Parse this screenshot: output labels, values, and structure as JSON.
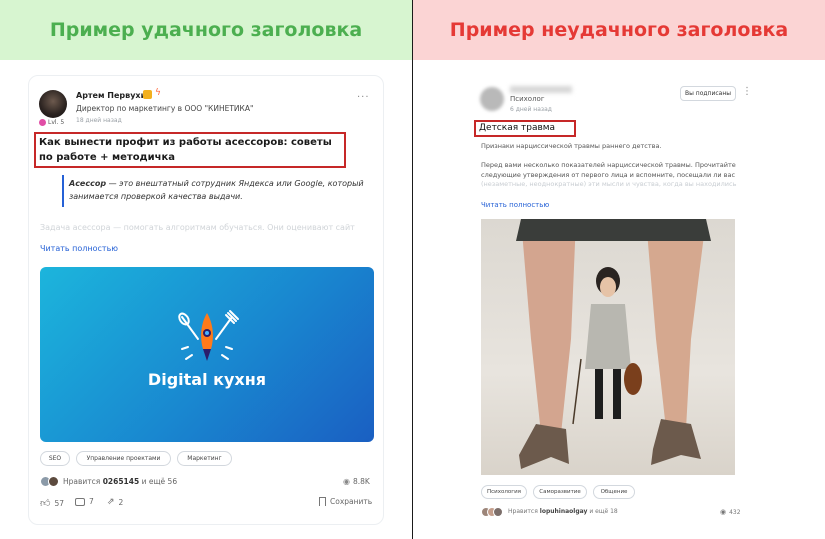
{
  "left": {
    "header": "Пример удачного заголовка",
    "author": {
      "name": "Артем Первухин",
      "role": "Директор по маркетингу в ООО \"КИНЕТИКА\"",
      "level": "Lvl. 5",
      "time": "18 дней назад"
    },
    "menu": "···",
    "title": "Как вынести профит из работы асессоров: советы по работе + методичка",
    "quote_term": "Асессор",
    "quote_rest": " — это внештатный сотрудник Яндекса или Google, который занимается проверкой качества выдачи.",
    "faded_text": "Задача асессора — помогать алгоритмам обучаться. Они оценивают сайт",
    "read_more": "Читать полностью",
    "image_caption": "Digital кухня",
    "tags": [
      "SEO",
      "Управление проектами",
      "Маркетинг"
    ],
    "likes_text": "Нравится",
    "likes_user": "0265145",
    "likes_more": "и ещё 56",
    "views": "8.8K",
    "stats": {
      "likes": "57",
      "comments": "7",
      "reposts": "2",
      "save": "Сохранить"
    },
    "colors": {
      "accent": "#2561d6",
      "banner_from": "#1ab0d8",
      "banner_to": "#1565c0",
      "highlight": "#c62828"
    }
  },
  "right": {
    "header": "Пример неудачного заголовка",
    "author": {
      "role": "Психолог",
      "time": "6 дней назад"
    },
    "subscribe": "Вы подписаны",
    "title": "Детская травма",
    "paragraph1": "Признаки нарциссической травмы раннего детства.",
    "paragraph2": "Перед вами несколько показателей нарциссической травмы. Прочитайте следующие утверждения от первого лица и вспомните, посещали ли вас",
    "paragraph3": "(незаметные, неоднократные) эти мысли и чувства, когда вы находились",
    "read_more": "Читать полностью",
    "tags": [
      "Психология",
      "Саморазвитие",
      "Общение"
    ],
    "likes_text": "Нравится",
    "likes_user": "lopuhinaolgay",
    "likes_more": "и ещё 18",
    "views": "432"
  }
}
